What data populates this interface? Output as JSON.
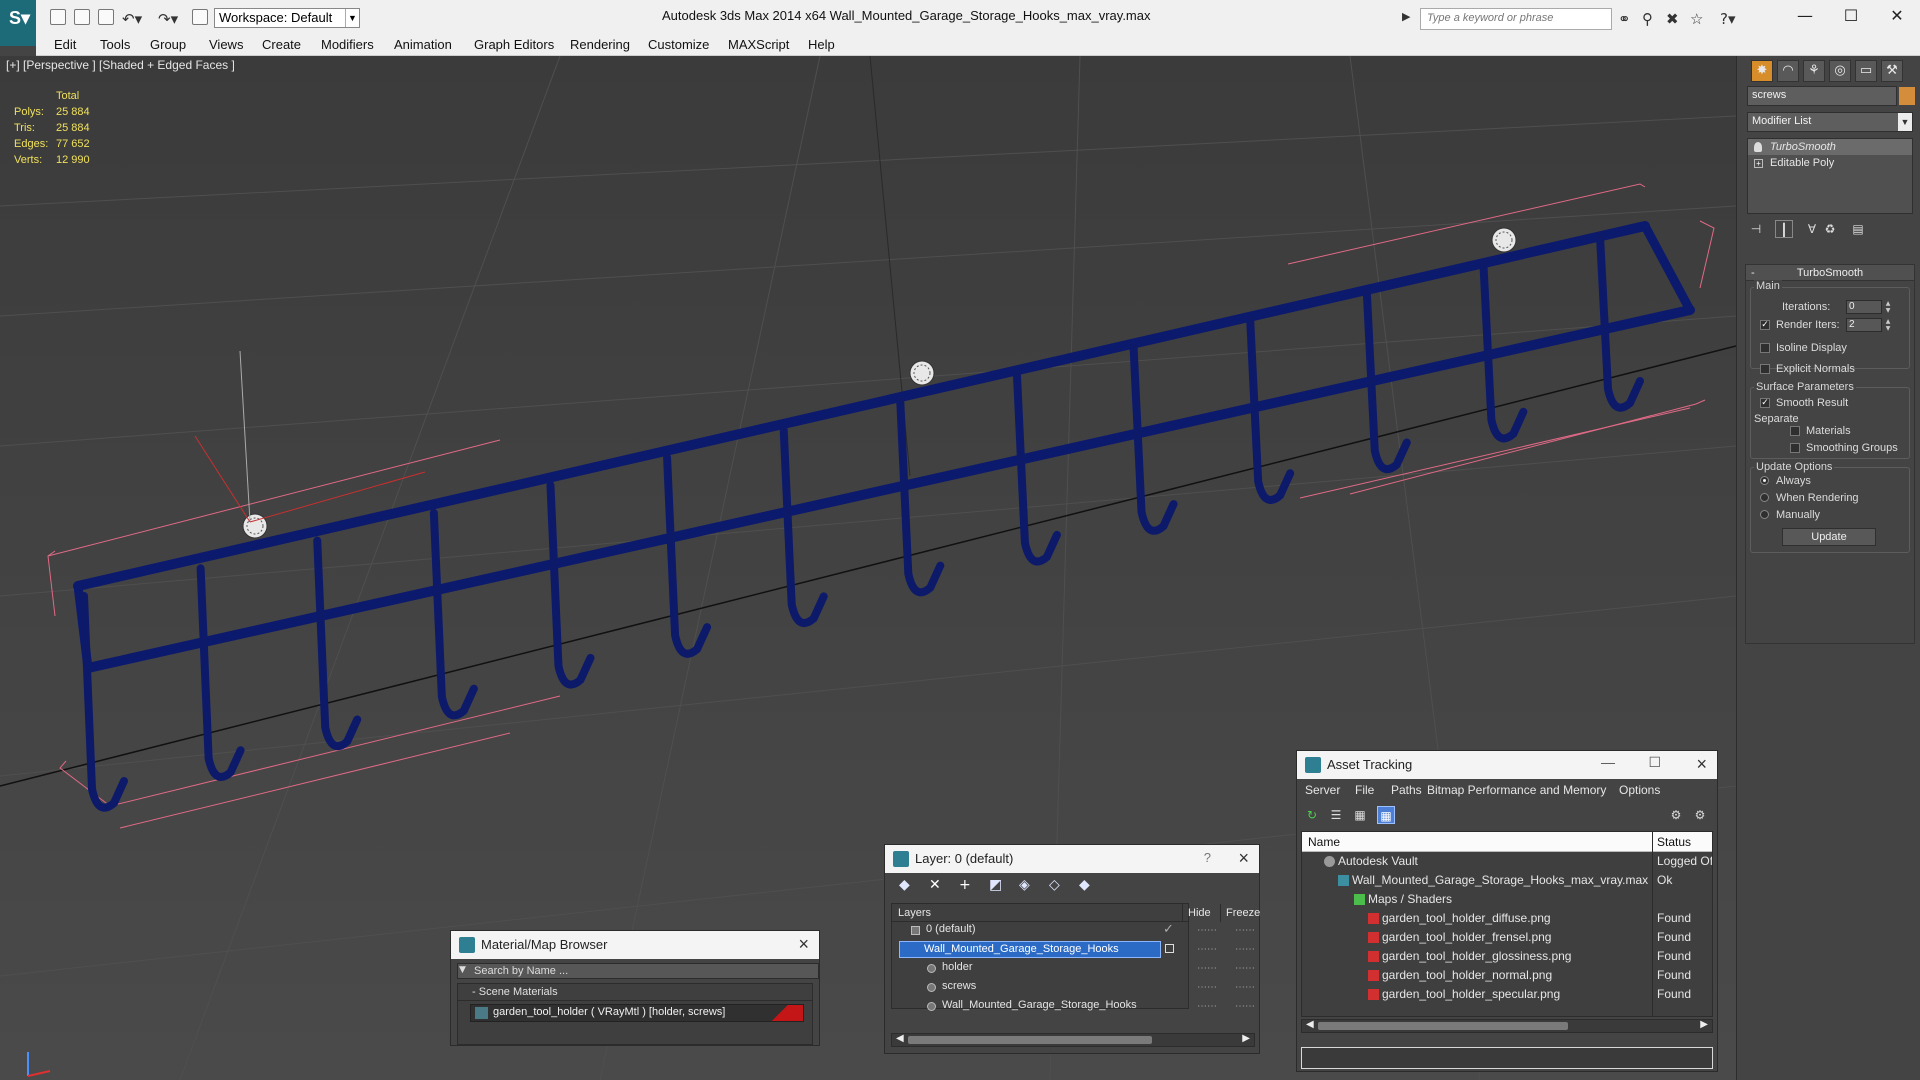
{
  "titlebar": {
    "app_title": "Autodesk 3ds Max  2014 x64      Wall_Mounted_Garage_Storage_Hooks_max_vray.max",
    "workspace": "Workspace: Default",
    "search_placeholder": "Type a keyword or phrase",
    "minimize": "—",
    "maximize": "☐",
    "close": "✕"
  },
  "menu": [
    "Edit",
    "Tools",
    "Group",
    "Views",
    "Create",
    "Modifiers",
    "Animation",
    "Graph Editors",
    "Rendering",
    "Customize",
    "MAXScript",
    "Help"
  ],
  "viewport": {
    "label": "[+] [Perspective ] [Shaded + Edged Faces ]",
    "stats": {
      "header": "Total",
      "polys_label": "Polys:",
      "polys": "25 884",
      "tris_label": "Tris:",
      "tris": "25 884",
      "edges_label": "Edges:",
      "edges": "77 652",
      "verts_label": "Verts:",
      "verts": "12 990"
    }
  },
  "command_panel": {
    "object_name": "screws",
    "object_color": "#d48d3a",
    "modifier_list": "Modifier List",
    "stack": [
      "TurboSmooth",
      "Editable Poly"
    ],
    "rollout_title": "TurboSmooth",
    "main_label": "Main",
    "iterations_label": "Iterations:",
    "iterations": "0",
    "render_iters_label": "Render Iters:",
    "render_iters": "2",
    "isoline_label": "Isoline Display",
    "explicit_normals_label": "Explicit Normals",
    "surface_params_label": "Surface Parameters",
    "smooth_result_label": "Smooth Result",
    "separate_label": "Separate",
    "materials_label": "Materials",
    "smoothing_groups_label": "Smoothing Groups",
    "update_options_label": "Update Options",
    "always_label": "Always",
    "when_rendering_label": "When Rendering",
    "manually_label": "Manually",
    "update_button": "Update"
  },
  "material_browser": {
    "title": "Material/Map Browser",
    "search_placeholder": "Search by Name ...",
    "section": "Scene Materials",
    "item": "garden_tool_holder ( VRayMtl ) [holder, screws]"
  },
  "layer_dialog": {
    "title": "Layer: 0 (default)",
    "help": "?",
    "col_layers": "Layers",
    "col_hide": "Hide",
    "col_freeze": "Freeze",
    "rows": [
      "0 (default)",
      "Wall_Mounted_Garage_Storage_Hooks",
      "holder",
      "screws",
      "Wall_Mounted_Garage_Storage_Hooks"
    ]
  },
  "asset_tracking": {
    "title": "Asset Tracking",
    "menu": [
      "Server",
      "File",
      "Paths",
      "Bitmap Performance and Memory",
      "Options"
    ],
    "col_name": "Name",
    "col_status": "Status",
    "rows": [
      {
        "name": "Autodesk Vault",
        "status": "Logged Of"
      },
      {
        "name": "Wall_Mounted_Garage_Storage_Hooks_max_vray.max",
        "status": "Ok"
      },
      {
        "name": "Maps / Shaders",
        "status": ""
      },
      {
        "name": "garden_tool_holder_diffuse.png",
        "status": "Found"
      },
      {
        "name": "garden_tool_holder_frensel.png",
        "status": "Found"
      },
      {
        "name": "garden_tool_holder_glossiness.png",
        "status": "Found"
      },
      {
        "name": "garden_tool_holder_normal.png",
        "status": "Found"
      },
      {
        "name": "garden_tool_holder_specular.png",
        "status": "Found"
      }
    ]
  }
}
